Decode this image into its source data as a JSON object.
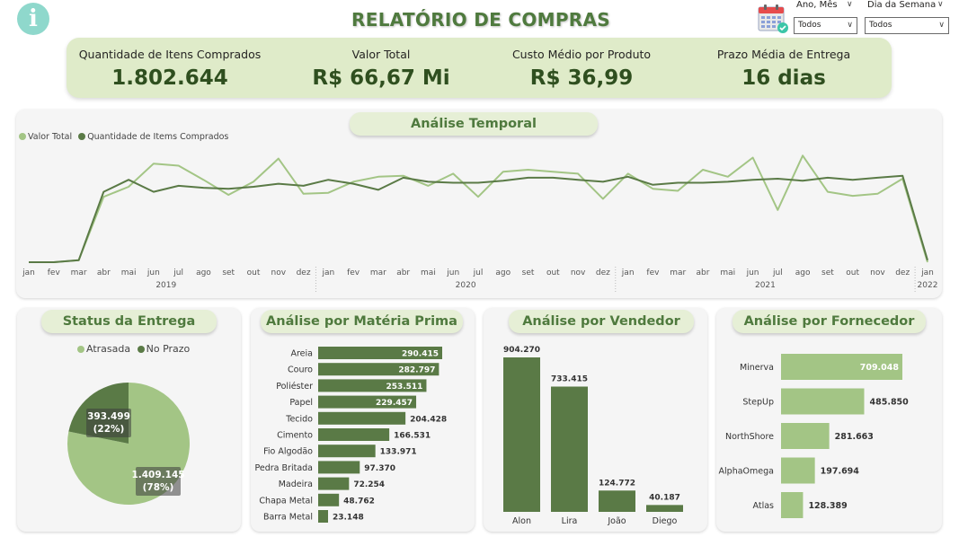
{
  "header": {
    "info_icon": "i",
    "title": "RELATÓRIO DE COMPRAS"
  },
  "slicers": {
    "ano_mes_label": "Ano, Mês",
    "ano_mes_value": "Todos",
    "dia_semana_label": "Dia da Semana",
    "dia_semana_value": "Todos"
  },
  "kpis": [
    {
      "label": "Quantidade de Itens Comprados",
      "value": "1.802.644"
    },
    {
      "label": "Valor Total",
      "value": "R$ 66,67 Mi"
    },
    {
      "label": "Custo Médio por Produto",
      "value": "R$ 36,99"
    },
    {
      "label": "Prazo Média de Entrega",
      "value": "16 dias"
    }
  ],
  "colors": {
    "light_green": "#a3c585",
    "dark_green": "#5a7a46",
    "title_green": "#4f7a3e",
    "kpi_bg": "#dfebc9"
  },
  "temporal": {
    "title": "Análise Temporal",
    "legend": [
      "Valor Total",
      "Quantidade de Items Comprados"
    ]
  },
  "status": {
    "title": "Status da Entrega",
    "legend": [
      "Atrasada",
      "No Prazo"
    ]
  },
  "materia": {
    "title": "Análise por Matéria Prima"
  },
  "vendedor": {
    "title": "Análise por Vendedor"
  },
  "fornecedor": {
    "title": "Análise por Fornecedor"
  },
  "chart_data": [
    {
      "type": "line",
      "title": "Análise Temporal",
      "x_months": [
        "jan",
        "fev",
        "mar",
        "abr",
        "mai",
        "jun",
        "jul",
        "ago",
        "set",
        "out",
        "nov",
        "dez",
        "jan",
        "fev",
        "mar",
        "abr",
        "mai",
        "jun",
        "jul",
        "ago",
        "set",
        "out",
        "nov",
        "dez",
        "jan",
        "fev",
        "mar",
        "abr",
        "mai",
        "jun",
        "jul",
        "ago",
        "set",
        "out",
        "nov",
        "dez",
        "jan"
      ],
      "x_years": [
        {
          "label": "2019",
          "start": 0,
          "end": 11
        },
        {
          "label": "2020",
          "start": 12,
          "end": 23
        },
        {
          "label": "2021",
          "start": 24,
          "end": 35
        },
        {
          "label": "2022",
          "start": 36,
          "end": 36
        }
      ],
      "ylim": [
        0,
        100
      ],
      "grid": false,
      "legend_position": "top-left",
      "series": [
        {
          "name": "Valor Total",
          "color": "#a3c585",
          "values": [
            0,
            0,
            2,
            65,
            75,
            98,
            96,
            82,
            67,
            80,
            103,
            68,
            69,
            80,
            85,
            86,
            76,
            88,
            65,
            90,
            92,
            90,
            88,
            63,
            88,
            73,
            71,
            92,
            85,
            104,
            52,
            106,
            70,
            66,
            68,
            83,
            0
          ]
        },
        {
          "name": "Quantidade de Items Comprados",
          "color": "#5a7a46",
          "values": [
            0,
            0,
            2,
            70,
            82,
            70,
            76,
            74,
            73,
            75,
            78,
            76,
            82,
            78,
            72,
            84,
            80,
            79,
            79,
            81,
            84,
            84,
            82,
            80,
            85,
            77,
            79,
            79,
            80,
            82,
            83,
            81,
            84,
            82,
            84,
            86,
            2
          ]
        }
      ]
    },
    {
      "type": "pie",
      "title": "Status da Entrega",
      "legend_position": "top",
      "categories": [
        "Atrasada",
        "No Prazo"
      ],
      "values": [
        1409145,
        393499
      ],
      "labels": [
        "1.409.145",
        "393.499"
      ],
      "percent_labels": [
        "(78%)",
        "(22%)"
      ],
      "colors": [
        "#a3c585",
        "#5a7a46"
      ]
    },
    {
      "type": "bar",
      "orientation": "horizontal",
      "title": "Análise por Matéria Prima",
      "categories": [
        "Areia",
        "Couro",
        "Poliéster",
        "Papel",
        "Tecido",
        "Cimento",
        "Fio Algodão",
        "Pedra Britada",
        "Madeira",
        "Chapa Metal",
        "Barra Metal"
      ],
      "values": [
        290415,
        282797,
        253511,
        229457,
        204428,
        166531,
        133971,
        97370,
        72254,
        48762,
        23148
      ],
      "labels": [
        "290.415",
        "282.797",
        "253.511",
        "229.457",
        "204.428",
        "166.531",
        "133.971",
        "97.370",
        "72.254",
        "48.762",
        "23.148"
      ],
      "color": "#5a7a46"
    },
    {
      "type": "bar",
      "orientation": "vertical",
      "title": "Análise por Vendedor",
      "categories": [
        "Alon",
        "Lira",
        "João",
        "Diego"
      ],
      "values": [
        904270,
        733415,
        124772,
        40187
      ],
      "labels": [
        "904.270",
        "733.415",
        "124.772",
        "40.187"
      ],
      "color": "#5a7a46"
    },
    {
      "type": "bar",
      "orientation": "horizontal",
      "title": "Análise por Fornecedor",
      "categories": [
        "Minerva",
        "StepUp",
        "NorthShore",
        "AlphaOmega",
        "Atlas"
      ],
      "values": [
        709048,
        485850,
        281663,
        197694,
        128389
      ],
      "labels": [
        "709.048",
        "485.850",
        "281.663",
        "197.694",
        "128.389"
      ],
      "color": "#a3c585"
    }
  ]
}
